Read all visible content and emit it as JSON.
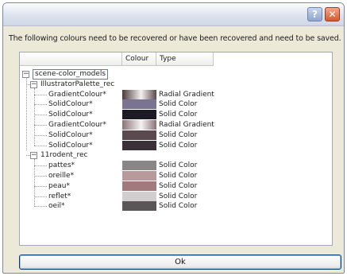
{
  "dialog": {
    "message": "The following colours need to be recovered or have been recovered and need to be saved.",
    "help_label": "?",
    "close_label": "✕",
    "ok_label": "Ok"
  },
  "columns": [
    "Colour",
    "Type"
  ],
  "tree": {
    "root": "scene-color_models",
    "groups": [
      {
        "name": "IllustratorPalette_rec",
        "items": [
          {
            "name": "GradientColour*",
            "type": "Radial Gradient",
            "swatch": "linear-gradient(90deg,#4a3a3c,#f4f0f0 55%,#5a4a4c)"
          },
          {
            "name": "SolidColour*",
            "type": "Solid Color",
            "swatch": "#7a7392"
          },
          {
            "name": "SolidColour*",
            "type": "Solid Color",
            "swatch": "#1c1a22"
          },
          {
            "name": "GradientColour*",
            "type": "Radial Gradient",
            "swatch": "linear-gradient(90deg,#8a7278,#f6f2f2 55%,#8a7278)"
          },
          {
            "name": "SolidColour*",
            "type": "Solid Color",
            "swatch": "#5a4a50"
          },
          {
            "name": "SolidColour*",
            "type": "Solid Color",
            "swatch": "#3a3038"
          }
        ]
      },
      {
        "name": "11rodent_rec",
        "items": [
          {
            "name": "pattes*",
            "type": "Solid Color",
            "swatch": "#8a8688"
          },
          {
            "name": "oreille*",
            "type": "Solid Color",
            "swatch": "#b89a9c"
          },
          {
            "name": "peau*",
            "type": "Solid Color",
            "swatch": "#a27a7e"
          },
          {
            "name": "reflet*",
            "type": "Solid Color",
            "swatch": "#d2ced0"
          },
          {
            "name": "oeil*",
            "type": "Solid Color",
            "swatch": "#5a5658"
          }
        ]
      }
    ]
  }
}
